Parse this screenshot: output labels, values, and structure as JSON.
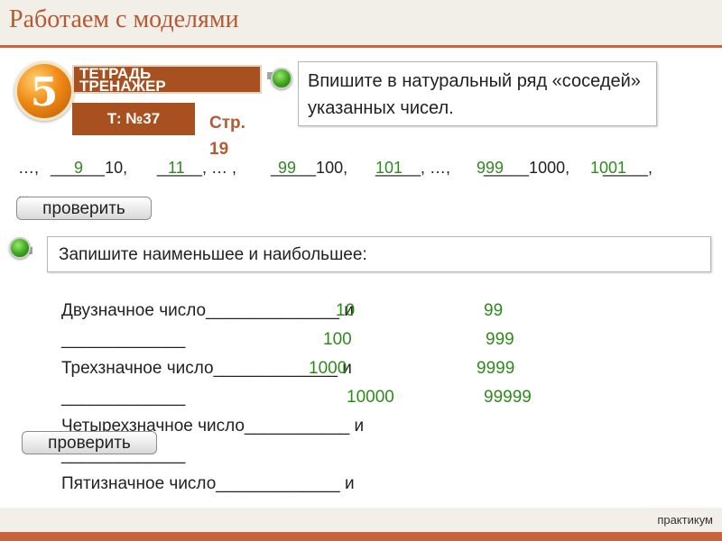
{
  "header": {
    "title": "Работаем с моделями"
  },
  "badge": {
    "number": "5",
    "notebook_line1": "ТЕТРАДЬ",
    "notebook_line2": "ТРЕНАЖЕР",
    "task": "Т: №37",
    "page": "Стр. 19"
  },
  "task1": {
    "instruction": "Впишите в натуральный ряд «соседей» указанных чисел.",
    "sequence": [
      "…, ",
      "______10, ",
      "_____, … , ",
      "_____100,",
      "_____, …, ",
      "_____1000,",
      "_____,"
    ],
    "answers": [
      "9",
      "11",
      "99",
      "101",
      "999",
      "1001"
    ],
    "dots": "…",
    "check_label": "проверить"
  },
  "task2": {
    "instruction": "Запишите наименьшее и наибольшее:",
    "rows": [
      {
        "text": "Двузначное число______________ и",
        "blank": "_____________",
        "min": "10",
        "max": "99"
      },
      {
        "text": "Трехзначное число_____________ и",
        "blank": "_____________",
        "min": "100",
        "max": "999"
      },
      {
        "text": "Четырехзначное число___________ и",
        "blank": "_____________",
        "min": "1000",
        "max": "9999"
      },
      {
        "text": "Пятизначное число_____________ и",
        "blank": "_____________",
        "min": "10000",
        "max": "99999"
      }
    ],
    "check_label": "проверить"
  },
  "footer": {
    "label": "практикум"
  },
  "colors": {
    "accent": "#c9633c",
    "brown": "#a8501f",
    "answer_green": "#2f8a1d",
    "band": "#f2eee8"
  }
}
